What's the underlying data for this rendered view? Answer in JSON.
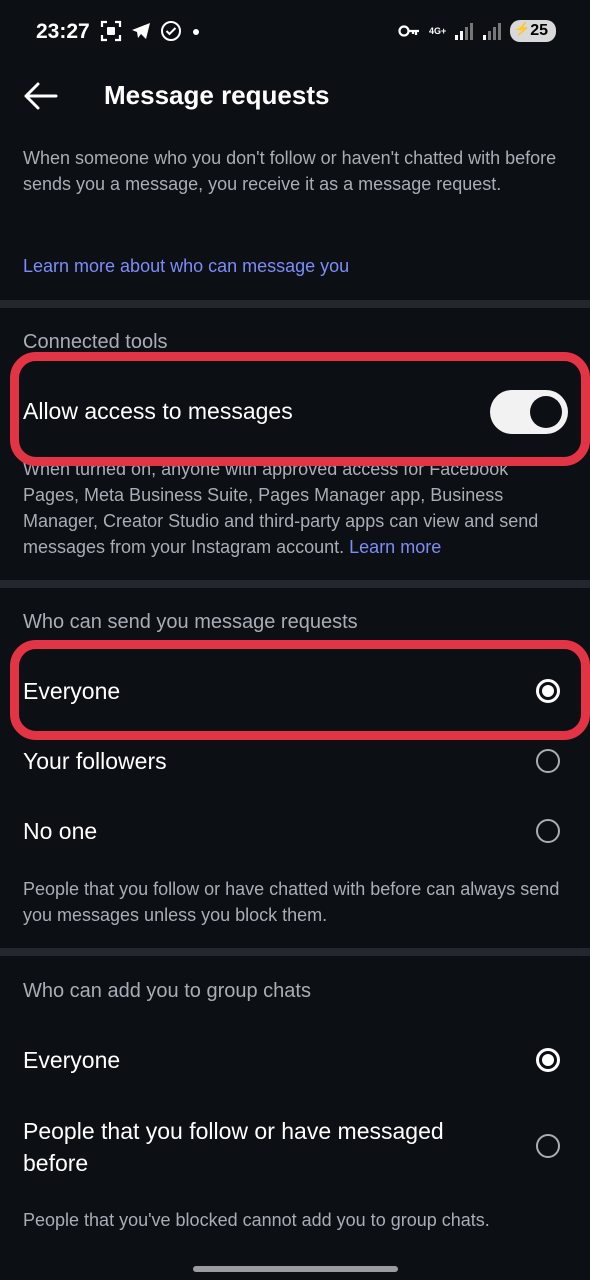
{
  "status_bar": {
    "time": "23:27",
    "network": "4G+",
    "battery": "25",
    "icons": [
      "screenshot-icon",
      "telegram-icon",
      "check-circle-icon",
      "dot-icon",
      "key-icon",
      "signal-icon",
      "battery-icon"
    ]
  },
  "header": {
    "title": "Message requests",
    "back_icon": "arrow-left-icon"
  },
  "intro": {
    "text": "When someone who you don't follow or haven't chatted with before sends you a message, you receive it as a message request.",
    "link": "Learn more about who can message you"
  },
  "connected_tools": {
    "title": "Connected tools",
    "toggle_label": "Allow access to messages",
    "toggle_on": true,
    "description": "When turned on, anyone with approved access for Facebook Pages, Meta Business Suite, Pages Manager app, Business Manager, Creator Studio and third-party apps can view and send messages from your Instagram account.",
    "learn_more": "Learn more"
  },
  "message_requests": {
    "title": "Who can send you message requests",
    "options": [
      {
        "label": "Everyone",
        "selected": true
      },
      {
        "label": "Your followers",
        "selected": false
      },
      {
        "label": "No one",
        "selected": false
      }
    ],
    "note": "People that you follow or have chatted with before can always send you messages unless you block them."
  },
  "group_chats": {
    "title": "Who can add you to group chats",
    "options": [
      {
        "label": "Everyone",
        "selected": true
      },
      {
        "label": "People that you follow or have messaged before",
        "selected": false
      }
    ],
    "note": "People that you've blocked cannot add you to group chats."
  },
  "colors": {
    "background": "#0c0f14",
    "link": "#7d8cf8",
    "highlight": "#e23444",
    "secondary_text": "#a9adb5"
  }
}
